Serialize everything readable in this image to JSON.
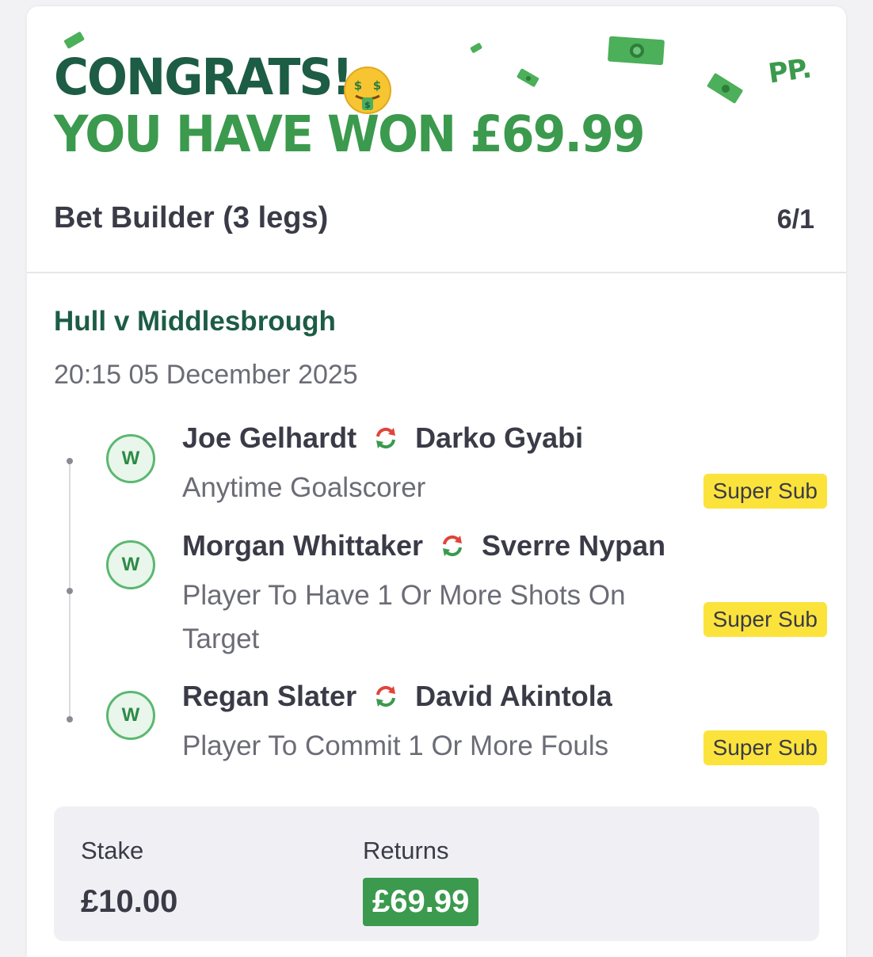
{
  "header": {
    "congrats": "CONGRATS!",
    "won_text": "YOU HAVE WON £69.99",
    "logo": "PP.",
    "emoji_icon": "money-mouth-face-icon"
  },
  "bet": {
    "title": "Bet Builder (3 legs)",
    "odds": "6/1"
  },
  "event": {
    "name": "Hull v Middlesbrough",
    "datetime": "20:15 05 December 2025"
  },
  "legs": [
    {
      "result": "W",
      "player_out": "Joe Gelhardt",
      "player_in": "Darko Gyabi",
      "market": "Anytime Goalscorer",
      "tag": "Super Sub"
    },
    {
      "result": "W",
      "player_out": "Morgan Whittaker",
      "player_in": "Sverre Nypan",
      "market": "Player To Have 1 Or More Shots On Target",
      "tag": "Super Sub"
    },
    {
      "result": "W",
      "player_out": "Regan Slater",
      "player_in": "David Akintola",
      "market": "Player To Commit 1 Or More Fouls",
      "tag": "Super Sub"
    }
  ],
  "summary": {
    "stake_label": "Stake",
    "stake_value": "£10.00",
    "returns_label": "Returns",
    "returns_value": "£69.99"
  },
  "colors": {
    "dark_green": "#1d5c45",
    "brand_green": "#3b9a4d",
    "super_sub_yellow": "#fbe33c",
    "swap_red": "#e0443a"
  }
}
